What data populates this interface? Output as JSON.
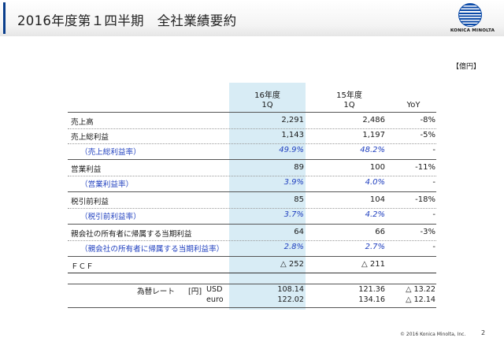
{
  "header": {
    "title": "2016年度第１四半期　全社業績要約",
    "logo_text": "KONICA MINOLTA"
  },
  "unit_label": "【億円】",
  "columns": {
    "c1_line1": "16年度",
    "c1_line2": "1Q",
    "c2_line1": "15年度",
    "c2_line2": "1Q",
    "c3": "YoY"
  },
  "rows": [
    {
      "label": "売上高",
      "v1": "2,291",
      "v2": "2,486",
      "v3": "-8%"
    },
    {
      "label": "売上総利益",
      "v1": "1,143",
      "v2": "1,197",
      "v3": "-5%"
    },
    {
      "label": "（売上総利益率）",
      "v1": "49.9%",
      "v2": "48.2%",
      "v3": "-"
    },
    {
      "label": "営業利益",
      "v1": "89",
      "v2": "100",
      "v3": "-11%"
    },
    {
      "label": "（営業利益率）",
      "v1": "3.9%",
      "v2": "4.0%",
      "v3": "-"
    },
    {
      "label": "税引前利益",
      "v1": "85",
      "v2": "104",
      "v3": "-18%"
    },
    {
      "label": "（税引前利益率）",
      "v1": "3.7%",
      "v2": "4.2%",
      "v3": "-"
    },
    {
      "label": "親会社の所有者に帰属する当期利益",
      "v1": "64",
      "v2": "66",
      "v3": "-3%"
    },
    {
      "label": "（親会社の所有者に帰属する当期利益率）",
      "v1": "2.8%",
      "v2": "2.7%",
      "v3": "-"
    },
    {
      "label": "ＦＣＦ",
      "v1": "△ 252",
      "v2": "△ 211",
      "v3": ""
    }
  ],
  "fx": {
    "label": "為替レート",
    "unit": "[円]",
    "usd_label": "USD",
    "euro_label": "euro",
    "usd": {
      "v1": "108.14",
      "v2": "121.36",
      "v3": "△ 13.22"
    },
    "euro": {
      "v1": "122.02",
      "v2": "134.16",
      "v3": "△ 12.14"
    }
  },
  "footer": {
    "copyright": "© 2016 Konica Minolta, Inc.",
    "page_number": "2"
  }
}
